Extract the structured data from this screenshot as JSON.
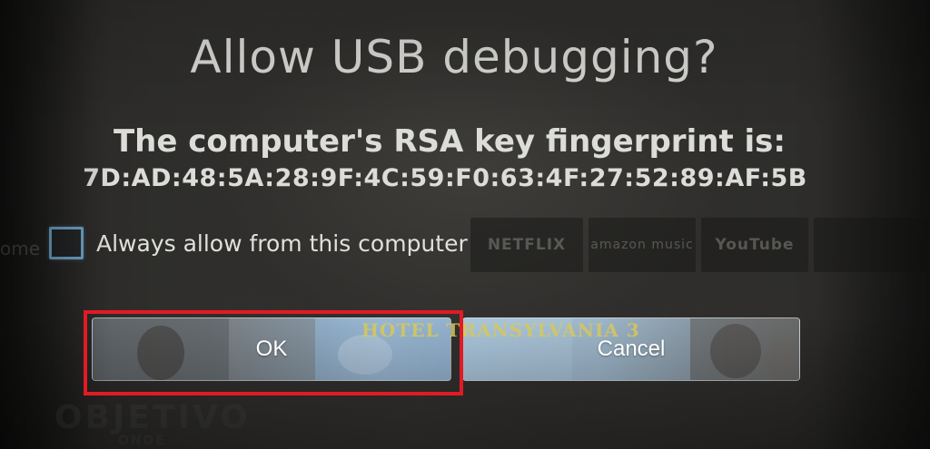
{
  "dialog": {
    "title": "Allow USB debugging?",
    "message_line1": "The computer's RSA key fingerprint is:",
    "fingerprint": "7D:AD:48:5A:28:9F:4C:59:F0:63:4F:27:52:89:AF:5B",
    "checkbox_label": "Always allow from this computer",
    "checkbox_checked": false,
    "ok_label": "OK",
    "cancel_label": "Cancel"
  },
  "background": {
    "home_label": "ome",
    "tiles": [
      "NETFLIX",
      "amazon music",
      "YouTube"
    ],
    "poster_title": "HOTEL TRANSYLVANIA 3",
    "bottom_text": "OBJETIVO",
    "bottom_sub": "ONDE"
  },
  "highlight_color": "#e01b24",
  "checkbox_color": "#6fa3c6",
  "icons": {
    "checkbox": "checkbox-unchecked-icon"
  }
}
